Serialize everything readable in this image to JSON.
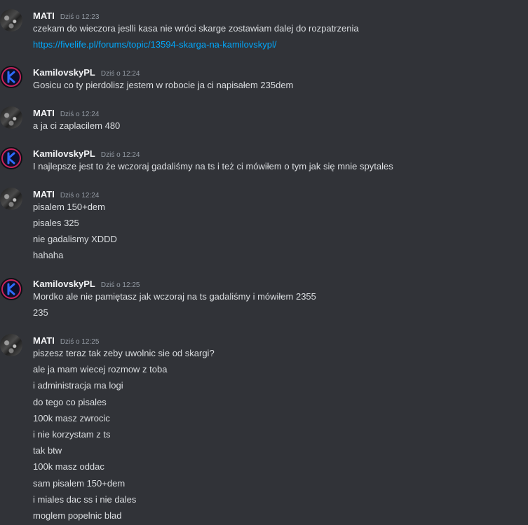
{
  "messages": [
    {
      "author": "MATI",
      "time": "Dziś o 12:23",
      "avatar": "mati-avatar",
      "lines": [
        "czekam do wieczora jeslli kasa nie wróci skarge zostawiam dalej do rozpatrzenia",
        "https://fivelife.pl/forums/topic/13594-skarga-na-kamilovskypl/"
      ]
    },
    {
      "author": "KamilovskyPL",
      "time": "Dziś o 12:24",
      "avatar": "kamilovsky-avatar",
      "lines": [
        "Gosicu co ty pierdolisz jestem w robocie ja ci napisałem 235dem"
      ]
    },
    {
      "author": "MATI",
      "time": "Dziś o 12:24",
      "avatar": "mati-avatar",
      "lines": [
        "a ja ci zaplacilem 480"
      ]
    },
    {
      "author": "KamilovskyPL",
      "time": "Dziś o 12:24",
      "avatar": "kamilovsky-avatar",
      "lines": [
        "I najlepsze jest to że wczoraj gadaliśmy na ts i też ci mówiłem o tym jak się mnie spytales"
      ]
    },
    {
      "author": "MATI",
      "time": "Dziś o 12:24",
      "avatar": "mati-avatar",
      "lines": [
        "pisalem 150+dem",
        "pisales 325",
        "nie gadalismy XDDD",
        "hahaha"
      ]
    },
    {
      "author": "KamilovskyPL",
      "time": "Dziś o 12:25",
      "avatar": "kamilovsky-avatar",
      "lines": [
        "Mordko ale nie pamiętasz jak wczoraj na ts gadaliśmy i mówiłem 2355",
        "235"
      ]
    },
    {
      "author": "MATI",
      "time": "Dziś o 12:25",
      "avatar": "mati-avatar",
      "lines": [
        "piszesz teraz tak zeby uwolnic sie od skargi?",
        "ale ja mam wiecej rozmow z toba",
        "i administracja ma logi",
        "do tego co pisales",
        "100k masz zwrocic",
        "i nie korzystam z ts",
        "tak btw",
        "100k masz oddac",
        "sam pisalem 150+dem",
        "i miales dac ss i nie dales",
        "moglem popelnic blad"
      ]
    }
  ],
  "colors": {
    "background": "#313338",
    "author": "#f2f3f5",
    "text": "#dbdee1",
    "timestamp": "#949ba4",
    "link": "#00a8fc",
    "kamilovsky_accent": "#2f6bff"
  }
}
